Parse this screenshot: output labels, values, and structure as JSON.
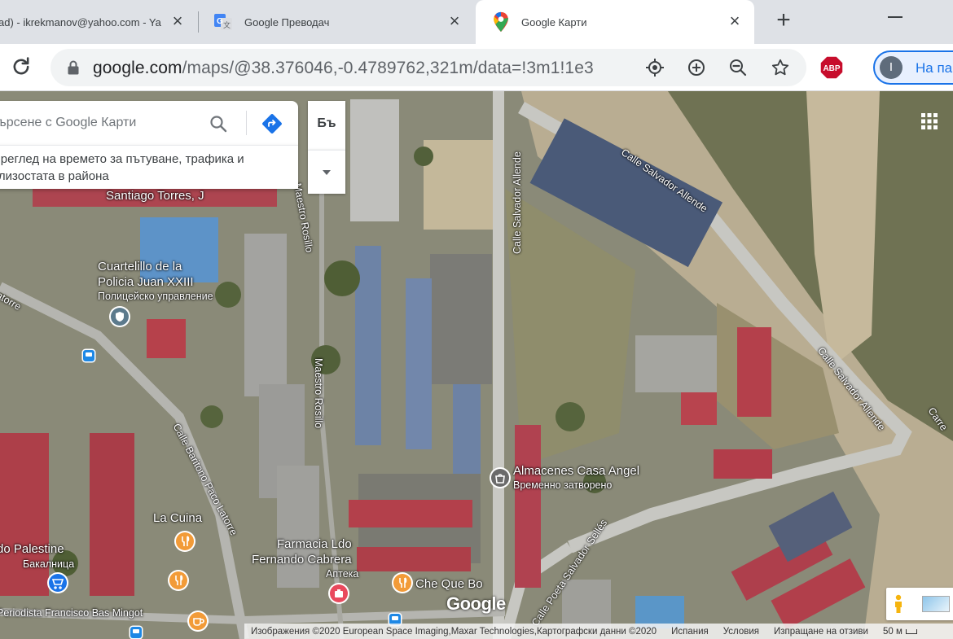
{
  "tabs": [
    {
      "title": "ad) - ikrekmanov@yahoo.com - Yahoo",
      "active": false
    },
    {
      "title": "Google Преводач",
      "active": false
    },
    {
      "title": "Google Карти",
      "active": true
    }
  ],
  "icons": {
    "close": "×",
    "new_tab": "+",
    "reload": "reload-icon",
    "lock": "lock-icon"
  },
  "address_bar": {
    "host": "google.com",
    "path": "/maps/@38.376046,-0.4789762,321m/data=!3m1!1e3"
  },
  "extensions": {
    "abp_label": "ABP"
  },
  "profile": {
    "initial": "I",
    "label": "На па"
  },
  "map": {
    "search": {
      "placeholder": "Търсене с Google Карти"
    },
    "info_card": {
      "line1": "Преглед на времето за пътуване, трафика и",
      "line2": "близостата в района"
    },
    "layer_button": "Бъ",
    "labels": {
      "santiago": "Santiago Torres, J",
      "maestro_rosillo_top": "Maestro Rosillo",
      "maestro_rosillo_mid": "Maestro Rosillo",
      "calle_salvador_allende_v": "Calle Salvador Allende",
      "calle_salvador_allende_top": "Calle Salvador Allende",
      "calle_salvador_allende_right": "Calle Salvador Allende",
      "cuartelillo_1": "Cuartelillo de la",
      "cuartelillo_2": "Policia Juan XXIII",
      "cuartelillo_sub": "Полицейско управление",
      "latorre_left": "Latorre",
      "calle_baritono": "Calle Baritono Paco Latorre",
      "la_cuina": "La Cuina",
      "palestine": "do Palestine",
      "palestine_sub": "Бакалница",
      "farmacia_1": "Farmacia Ldo",
      "farmacia_2": "Fernando Cabrera",
      "farmacia_sub": "Аптека",
      "che_que_bo": "Che Que Bo",
      "almacenes": "Almacenes Casa Angel",
      "almacenes_sub": "Временно затворено",
      "calle_poeta": "Calle Poeta Salvador Sellés",
      "periodista": "Periodista Francisco Bas Mingot",
      "carre": "Carre"
    },
    "logo": "Google",
    "attribution": {
      "imagery": "Изображения ©2020 European Space Imaging,Maxar Technologies,Картографски данни ©2020",
      "country": "Испания",
      "terms": "Условия",
      "feedback": "Изпращане на отзиви",
      "scale": "50 м"
    }
  }
}
